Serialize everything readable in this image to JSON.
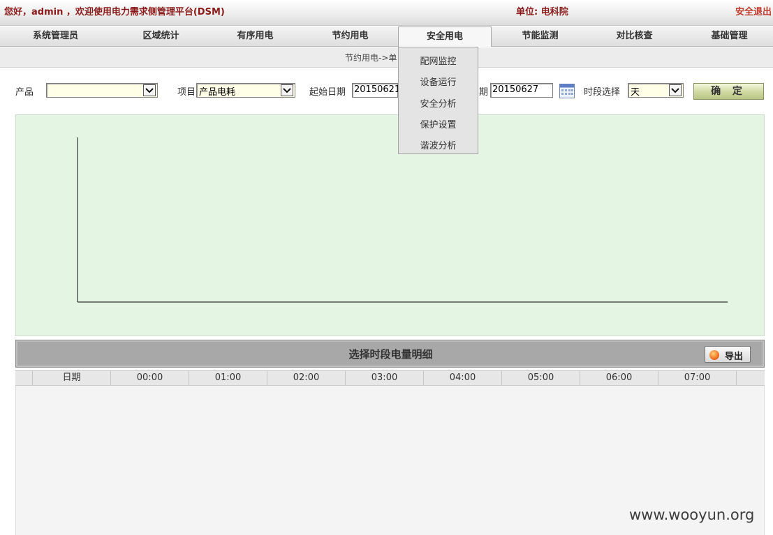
{
  "header": {
    "greeting": "您好，admin ，欢迎使用电力需求侧管理平台(DSM)",
    "unit": "单位: 电科院",
    "logout": "安全退出"
  },
  "nav": {
    "items": [
      {
        "label": "系统管理员"
      },
      {
        "label": "区域统计"
      },
      {
        "label": "有序用电"
      },
      {
        "label": "节约用电"
      },
      {
        "label": "安全用电",
        "active": true
      },
      {
        "label": "节能监测"
      },
      {
        "label": "对比核查"
      },
      {
        "label": "基础管理"
      }
    ]
  },
  "breadcrumb": "节约用电->单",
  "dropdown": {
    "items": [
      "配网监控",
      "设备运行",
      "安全分析",
      "保护设置",
      "谐波分析"
    ]
  },
  "filters": {
    "product_label": "产品",
    "product_value": "",
    "project_label": "项目",
    "project_value": "产品电耗",
    "start_label": "起始日期",
    "start_value": "20150621",
    "end_label": "期",
    "end_value": "20150627",
    "period_label": "时段选择",
    "period_value": "天",
    "confirm": "确 定"
  },
  "detail": {
    "title": "选择时段电量明细",
    "export": "导出",
    "columns": [
      "",
      "日期",
      "00:00",
      "01:00",
      "02:00",
      "03:00",
      "04:00",
      "05:00",
      "06:00",
      "07:00"
    ]
  },
  "watermark": "www.wooyun.org",
  "colors": {
    "header_text": "#8b1a1a",
    "chart_bg": "#e4f5e4",
    "detail_header_bg": "#a8a8a8"
  }
}
